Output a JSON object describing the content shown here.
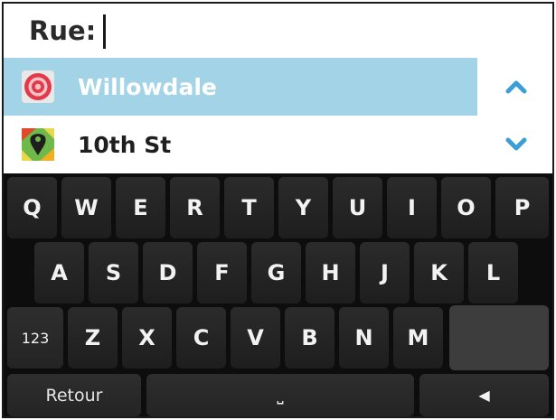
{
  "search": {
    "label": "Rue:",
    "value": ""
  },
  "suggestions": [
    {
      "label": "Willowdale",
      "icon": "target-icon",
      "selected": true
    },
    {
      "label": "10th St",
      "icon": "map-location-icon",
      "selected": false
    }
  ],
  "scroll": {
    "up_icon": "chevron-up-icon",
    "down_icon": "chevron-down-icon"
  },
  "keyboard": {
    "row1": [
      "Q",
      "W",
      "E",
      "R",
      "T",
      "Y",
      "U",
      "I",
      "O",
      "P"
    ],
    "row2": [
      "A",
      "S",
      "D",
      "F",
      "G",
      "H",
      "J",
      "K",
      "L"
    ],
    "row3": [
      "Z",
      "X",
      "C",
      "V",
      "B",
      "N",
      "M"
    ],
    "numbers_key": "123",
    "retour_key": "Retour",
    "space_key": "⎵",
    "backspace_key": "◀"
  },
  "colors": {
    "selected_row": "#a3d3e6",
    "accent": "#3b9fd6",
    "keyboard_bg": "#0d0d0d",
    "key_bg": "#2b2b2b"
  }
}
